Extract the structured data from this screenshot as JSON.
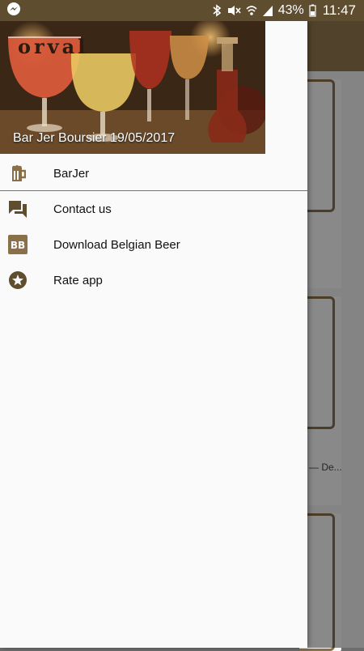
{
  "status_bar": {
    "battery_percent": "43%",
    "time": "11:47",
    "icons": [
      "messenger-icon",
      "bluetooth-icon",
      "mute-icon",
      "wifi-icon",
      "signal-icon",
      "battery-icon"
    ]
  },
  "drawer": {
    "header_caption": "Bar Jer Boursier 19/05/2017",
    "header_image_text": "orval",
    "items": [
      {
        "label": "BarJer",
        "icon": "beer-mug-icon"
      },
      {
        "label": "Contact us",
        "icon": "chat-icon"
      },
      {
        "label": "Download Belgian Beer",
        "icon": "bb-logo-icon"
      },
      {
        "label": "Rate app",
        "icon": "star-icon"
      }
    ]
  },
  "background": {
    "card_snippet": "— De..."
  },
  "colors": {
    "status_bar": "#5e4d2f",
    "accent": "#8a7049",
    "toolbar": "#947a4f"
  }
}
